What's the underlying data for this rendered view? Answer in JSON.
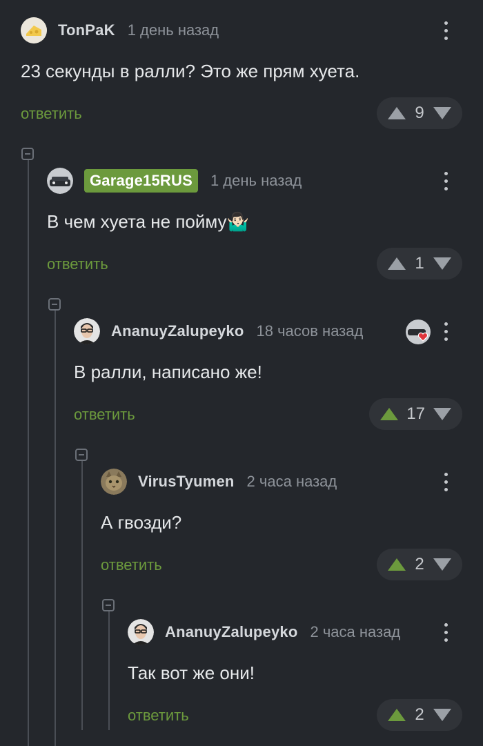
{
  "comments": [
    {
      "author": "TonPaK",
      "time": "1 день назад",
      "text": "23 секунды в ралли? Это же прям хуета.",
      "reply": "ответить",
      "rating": "9",
      "upvoted": false,
      "avatar_icon": "cheese-avatar-icon"
    },
    {
      "author": "Garage15RUS",
      "time": "1 день назад",
      "text": "В чем хуета не пойму🤷🏻‍♂️",
      "reply": "ответить",
      "rating": "1",
      "upvoted": false,
      "avatar_icon": "car-avatar-icon"
    },
    {
      "author": "AnanuyZalupeyko",
      "time": "18 часов назад",
      "text": "В ралли, написано же!",
      "reply": "ответить",
      "rating": "17",
      "upvoted": true,
      "avatar_icon": "man-glasses-avatar-icon"
    },
    {
      "author": "VirusTyumen",
      "time": "2 часа назад",
      "text": "А гвозди?",
      "reply": "ответить",
      "rating": "2",
      "upvoted": true,
      "avatar_icon": "cat-avatar-icon"
    },
    {
      "author": "AnanuyZalupeyko",
      "time": "2 часа назад",
      "text": "Так вот же они!",
      "reply": "ответить",
      "rating": "2",
      "upvoted": true,
      "avatar_icon": "man-glasses-avatar-icon"
    }
  ],
  "colors": {
    "background": "#24272c",
    "accent_green": "#6c9a3d",
    "muted": "#8e939a",
    "vote_pill": "#303338"
  }
}
